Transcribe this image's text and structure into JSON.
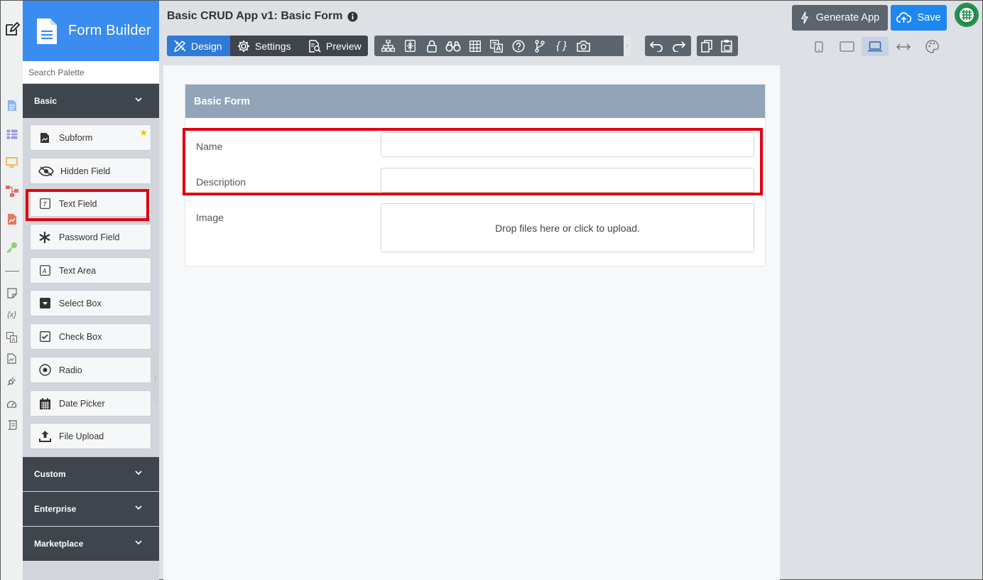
{
  "header": {
    "app_title": "Basic CRUD App v1: Basic Form",
    "mode_tabs": [
      {
        "label": "Design",
        "icon": "design-icon",
        "active": true
      },
      {
        "label": "Settings",
        "icon": "gear-icon",
        "active": false
      },
      {
        "label": "Preview",
        "icon": "preview-icon",
        "active": false
      }
    ],
    "toolbar_icons": [
      "sitemap-icon",
      "compress-icon",
      "lock-icon",
      "binoculars-icon",
      "table-icon",
      "translate-icon",
      "help-icon",
      "branch-icon",
      "json-icon",
      "camera-icon"
    ],
    "toolbar_json_label": "{ }",
    "generate_label": "Generate App",
    "save_label": "Save",
    "device_icons": [
      "phone-icon",
      "tablet-icon",
      "laptop-icon",
      "fit-width-icon",
      "palette-icon"
    ],
    "active_device": "laptop-icon"
  },
  "brand": {
    "title": "Form Builder"
  },
  "palette": {
    "search_placeholder": "Search Palette",
    "groups": [
      {
        "label": "Basic",
        "expanded": true
      },
      {
        "label": "Custom",
        "expanded": false
      },
      {
        "label": "Enterprise",
        "expanded": false
      },
      {
        "label": "Marketplace",
        "expanded": false
      }
    ],
    "items": [
      {
        "label": "Subform",
        "icon": "subform-icon",
        "starred": true
      },
      {
        "label": "Hidden Field",
        "icon": "eye-slash-icon"
      },
      {
        "label": "Text Field",
        "icon": "text-field-icon",
        "highlighted": true
      },
      {
        "label": "Password Field",
        "icon": "asterisk-icon"
      },
      {
        "label": "Text Area",
        "icon": "text-area-icon"
      },
      {
        "label": "Select Box",
        "icon": "select-box-icon"
      },
      {
        "label": "Check Box",
        "icon": "check-box-icon"
      },
      {
        "label": "Radio",
        "icon": "radio-icon"
      },
      {
        "label": "Date Picker",
        "icon": "calendar-icon"
      },
      {
        "label": "File Upload",
        "icon": "upload-icon"
      }
    ],
    "star_glyph": "★",
    "collapse_glyph": "‹"
  },
  "rail": {
    "icons": [
      "edit-icon",
      "document-icon",
      "grid-icon",
      "monitor-icon",
      "flow-icon",
      "report-icon",
      "key-icon",
      "note-icon",
      "variable-icon",
      "translate-icon",
      "file-icon",
      "plug-icon",
      "gauge-icon",
      "scroll-icon"
    ],
    "variable_label": "{x}"
  },
  "form": {
    "title": "Basic Form",
    "fields": [
      {
        "label": "Name",
        "type": "text",
        "value": ""
      },
      {
        "label": "Description",
        "type": "text",
        "value": ""
      },
      {
        "label": "Image",
        "type": "file",
        "drop_text": "Drop files here or click to upload."
      }
    ]
  },
  "colors": {
    "brand": "#3b8cf0",
    "active_tab": "#2f7ad6",
    "save": "#1e88f0",
    "highlight": "#e0000f",
    "form_header": "#92a5b8"
  }
}
